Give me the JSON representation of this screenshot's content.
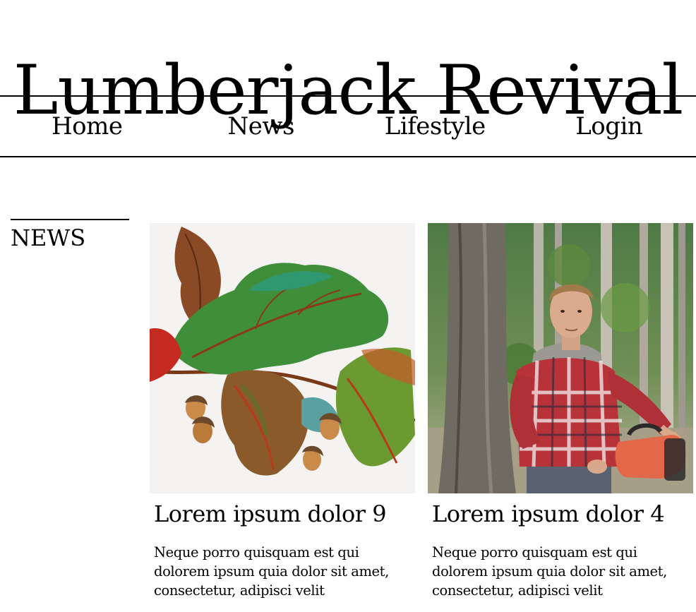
{
  "site": {
    "title": "Lumberjack Revival"
  },
  "nav": {
    "items": [
      "Home",
      "News",
      "Lifestyle",
      "Login"
    ]
  },
  "sidebar": {
    "heading": "NEWS"
  },
  "cards": [
    {
      "title": "Lorem ipsum dolor 9",
      "excerpt": "Neque porro quisquam est qui dolorem ipsum quia dolor sit amet, consectetur, adipisci velit",
      "image": "oak-leaves-acorns-illustration"
    },
    {
      "title": "Lorem ipsum dolor 4",
      "excerpt": "Neque porro quisquam est qui dolorem ipsum quia dolor sit amet, consectetur, adipisci velit",
      "image": "lumberjack-with-chainsaw-photo"
    }
  ]
}
